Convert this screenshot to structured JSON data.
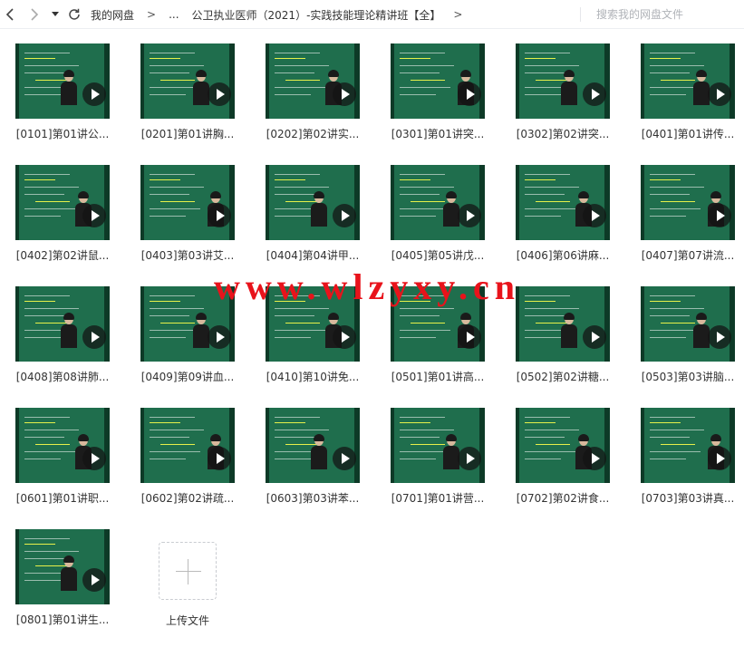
{
  "toolbar": {
    "back_icon": "chevron-left-icon",
    "forward_icon": "chevron-right-icon",
    "dropdown_icon": "caret-down-icon",
    "refresh_icon": "refresh-icon",
    "breadcrumb": [
      "我的网盘",
      "...",
      "公卫执业医师（2021）-实践技能理论精讲班【全】"
    ],
    "separator": ">",
    "search_placeholder": "搜索我的网盘文件"
  },
  "files": [
    "[0101]第01讲公...",
    "[0201]第01讲胸...",
    "[0202]第02讲实...",
    "[0301]第01讲突...",
    "[0302]第02讲突...",
    "[0401]第01讲传...",
    "[0402]第02讲鼠...",
    "[0403]第03讲艾...",
    "[0404]第04讲甲...",
    "[0405]第05讲戊...",
    "[0406]第06讲麻...",
    "[0407]第07讲流...",
    "[0408]第08讲肺...",
    "[0409]第09讲血...",
    "[0410]第10讲免...",
    "[0501]第01讲高...",
    "[0502]第02讲糖...",
    "[0503]第03讲脑...",
    "[0601]第01讲职...",
    "[0602]第02讲疏...",
    "[0603]第03讲苯...",
    "[0701]第01讲营...",
    "[0702]第02讲食...",
    "[0703]第03讲真...",
    "[0801]第01讲生..."
  ],
  "upload": {
    "label": "上传文件",
    "icon": "plus-icon"
  },
  "watermark": "www.wlzyxy.cn",
  "colors": {
    "slide_green": "#1f6e4d",
    "watermark_red": "#e8131b"
  }
}
